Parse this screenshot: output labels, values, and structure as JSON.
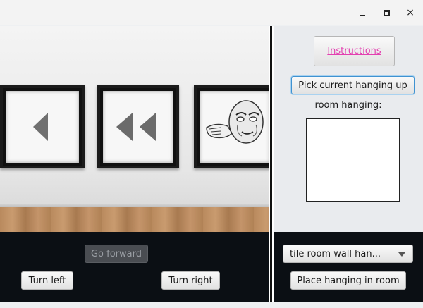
{
  "window": {
    "controls": [
      "minimize",
      "maximize",
      "close"
    ],
    "close_glyph": "×"
  },
  "scene": {
    "hangings": [
      "left-arrow-hanging",
      "double-left-arrow-hanging",
      "meme-face-hanging"
    ]
  },
  "side_panel": {
    "instructions_label": "Instructions",
    "pick_label": "Pick current hanging up",
    "room_hanging_label": "room hanging:"
  },
  "controls": {
    "go_forward_label": "Go forward",
    "turn_left_label": "Turn left",
    "turn_right_label": "Turn right",
    "select_value": "tile room wall han...",
    "place_label": "Place hanging in room"
  },
  "colors": {
    "link": "#e33fb0",
    "focus": "#3f92d1",
    "bottom_bar": "#0b0f14"
  }
}
